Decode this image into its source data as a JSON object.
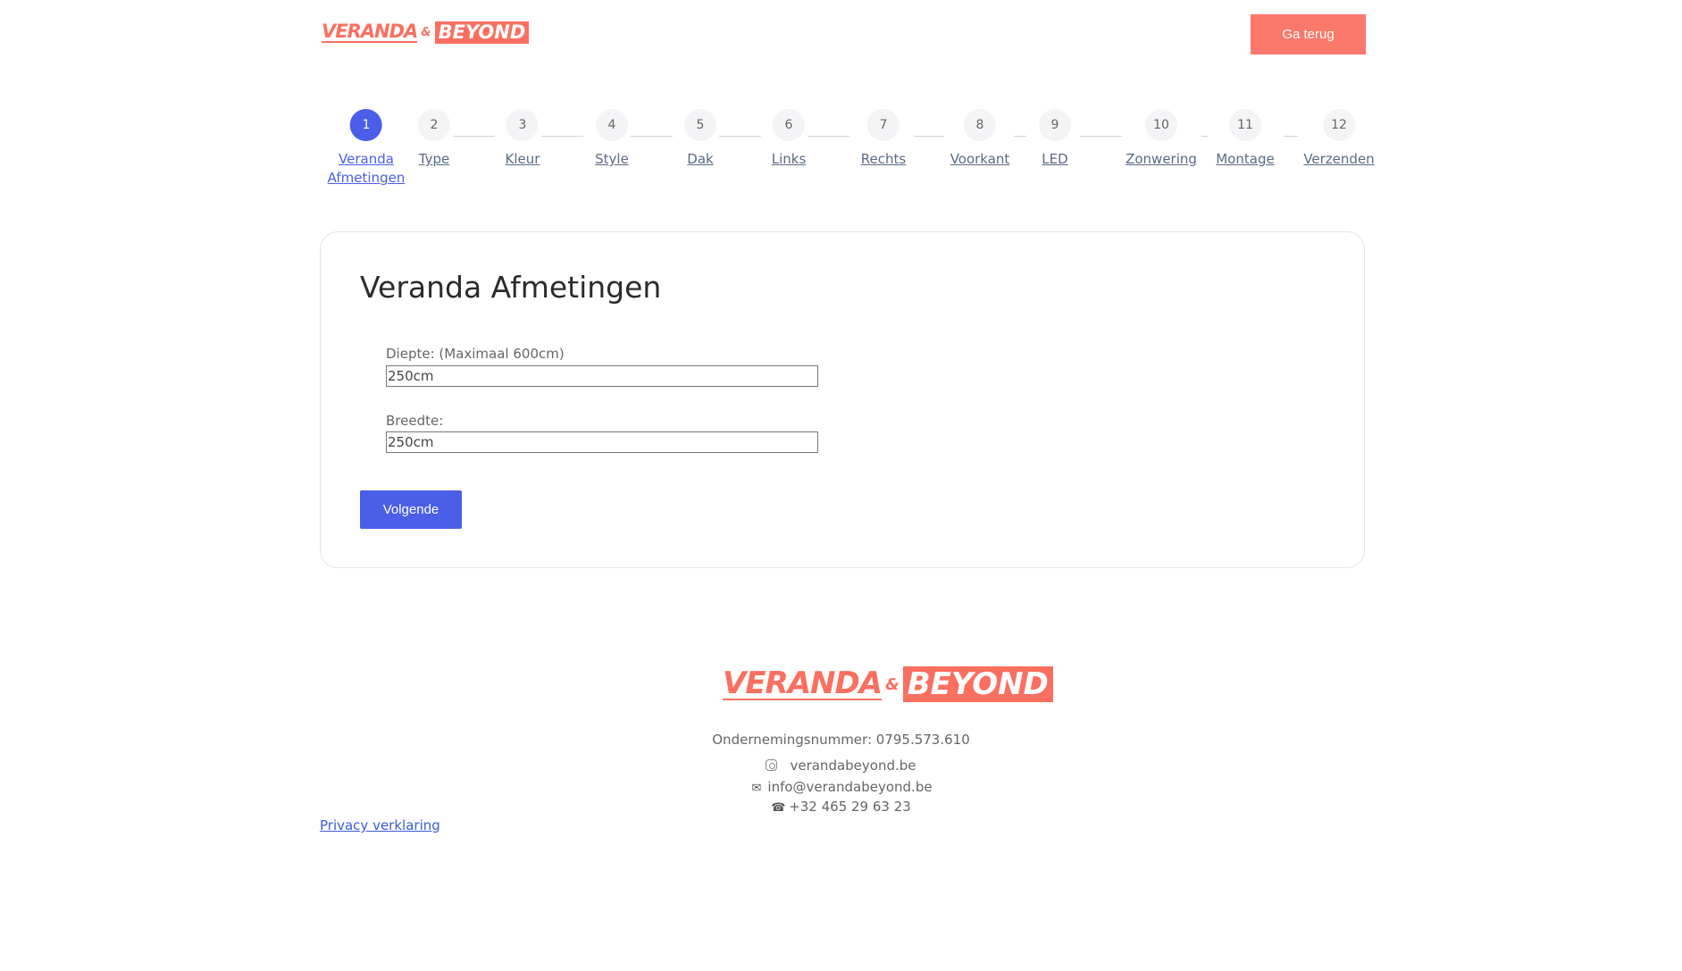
{
  "header": {
    "logo": {
      "word1": "VERANDA",
      "amp": "&",
      "word2": "BEYOND"
    },
    "back_label": "Ga terug"
  },
  "stepper": {
    "steps": [
      {
        "number": "1",
        "label_line1": "Veranda",
        "label_line2": "Afmetingen",
        "active": true
      },
      {
        "number": "2",
        "label_line1": "Type",
        "label_line2": "",
        "active": false
      },
      {
        "number": "3",
        "label_line1": "Kleur",
        "label_line2": "",
        "active": false
      },
      {
        "number": "4",
        "label_line1": "Style",
        "label_line2": "",
        "active": false
      },
      {
        "number": "5",
        "label_line1": "Dak",
        "label_line2": "",
        "active": false
      },
      {
        "number": "6",
        "label_line1": "Links",
        "label_line2": "",
        "active": false
      },
      {
        "number": "7",
        "label_line1": "Rechts",
        "label_line2": "",
        "active": false
      },
      {
        "number": "8",
        "label_line1": "Voorkant",
        "label_line2": "",
        "active": false
      },
      {
        "number": "9",
        "label_line1": "LED",
        "label_line2": "",
        "active": false
      },
      {
        "number": "10",
        "label_line1": "Zonwering",
        "label_line2": "",
        "active": false
      },
      {
        "number": "11",
        "label_line1": "Montage",
        "label_line2": "",
        "active": false
      },
      {
        "number": "12",
        "label_line1": "Verzenden",
        "label_line2": "",
        "active": false
      }
    ]
  },
  "form": {
    "title": "Veranda Afmetingen",
    "depth_label": "Diepte: (Maximaal 600cm)",
    "depth_value": "250cm",
    "width_label": "Breedte:",
    "width_value": "250cm",
    "next_label": "Volgende"
  },
  "footer": {
    "logo": {
      "word1": "VERANDA",
      "amp": "&",
      "word2": "BEYOND"
    },
    "company_number": "Ondernemingsnummer: 0795.573.610",
    "instagram": "verandabeyond.be",
    "email": "info@verandabeyond.be",
    "phone": "+32 465 29 63 23",
    "privacy_label": "Privacy verklaring"
  },
  "colors": {
    "brand": "#fa6f60",
    "primary": "#4a5ee8",
    "link": "#3b5bdb"
  },
  "icons": {
    "instagram": "instagram-icon",
    "email": "envelope-icon",
    "phone": "phone-icon"
  }
}
